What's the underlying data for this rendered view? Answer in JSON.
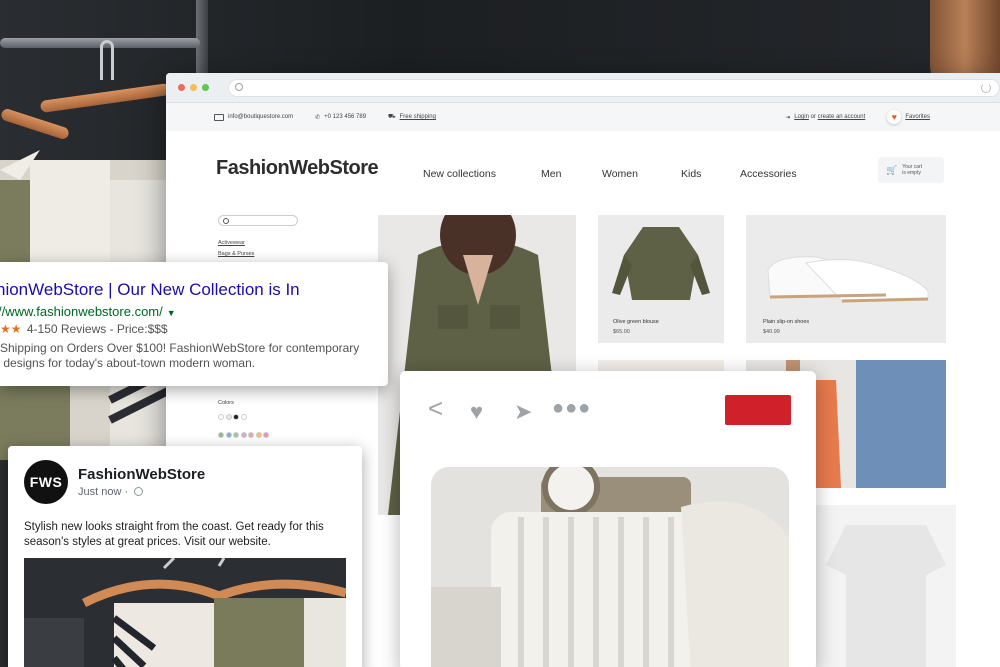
{
  "store": {
    "logo": "FashionWebStore",
    "topbar": {
      "email": "info@boutiquestore.com",
      "phone": "+0 123 456 789",
      "shipping": "Free shipping",
      "login": "Login",
      "or": "or",
      "create_account": "create an account",
      "favorites": "Favorites"
    },
    "nav": [
      "New collections",
      "Men",
      "Women",
      "Kids",
      "Accessories"
    ],
    "cart": {
      "line1": "Your cart",
      "line2": "is empty"
    },
    "sidebar": {
      "links": [
        "Activewear",
        "Bags & Purses"
      ],
      "colors_label": "Colors"
    },
    "swatch_colors": [
      "#ffffff",
      "#e6e6e6",
      "#222222",
      "#ffffff",
      "#8fbc8f",
      "#7fb3d5",
      "#9cc9a0",
      "#c3b1e1",
      "#f4a3a3",
      "#f5c26b",
      "#f48fb1"
    ],
    "products": [
      {
        "name": "Olive green blouse",
        "price": "$65.00"
      },
      {
        "name": "Plain slip-on shoes",
        "price": "$40.99"
      }
    ]
  },
  "google_ad": {
    "title": "hionWebStore | Our New Collection is In",
    "url": "//www.fashionwebstore.com/",
    "stars": "★★",
    "rating": "4-150 Reviews - Price:$$$",
    "desc_line1": "Shipping on Orders Over $100! FashionWebStore for contemporary",
    "desc_line2": "designs for today's about-town modern woman."
  },
  "facebook": {
    "avatar": "FWS",
    "name": "FashionWebStore",
    "time": "Just now ·",
    "text": "Stylish new looks straight from the coast. Get ready for this season's styles at great prices. Visit our website."
  },
  "pin_card": {
    "icons": [
      "back-icon",
      "heart-icon",
      "send-icon",
      "more-icon"
    ],
    "button_color": "#d0202a"
  }
}
